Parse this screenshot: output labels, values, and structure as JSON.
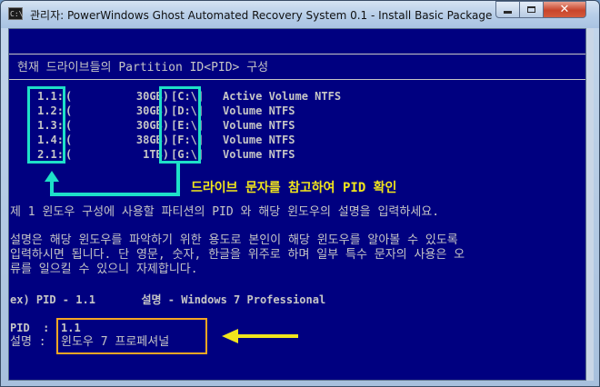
{
  "window": {
    "title": "관리자:  PowerWindows Ghost Automated Recovery System 0.1 - Install Basic Package",
    "icon": "console-app-icon",
    "icon_text": "C:\\",
    "controls": [
      "minimize-icon",
      "maximize-icon",
      "close-icon"
    ]
  },
  "console": {
    "header": "현재 드라이브들의 Partition ID<PID> 구성",
    "partitions": [
      {
        "pid": "1.1:",
        "size": "30GB)",
        "drive": "[C:\\]",
        "desc": "Active Volume NTFS"
      },
      {
        "pid": "1.2:",
        "size": "30GB)",
        "drive": "[D:\\]",
        "desc": "Volume NTFS"
      },
      {
        "pid": "1.3:",
        "size": "30GB)",
        "drive": "[E:\\]",
        "desc": "Volume NTFS"
      },
      {
        "pid": "1.4:",
        "size": "38GB)",
        "drive": "[F:\\]",
        "desc": "Volume NTFS"
      },
      {
        "pid": "2.1:",
        "size": "1TB)",
        "drive": "[G:\\]",
        "desc": "Volume NTFS"
      }
    ],
    "paren_open": "(",
    "annotation_hint": "드라이브 문자를 참고하여 PID 확인",
    "instruction": "제 1 윈도우 구성에 사용할 파티션의 PID 와 해당 윈도우의 설명을 입력하세요.",
    "help_line1": "설명은 해당 윈도우를 파악하기 위한 용도로 본인이 해당 윈도우를 알아볼 수 있도록",
    "help_line2": "입력하시면 됩니다. 단 영문, 숫자, 한글을 위주로 하며 일부 특수 문자의 사용은 오",
    "help_line3": "류를 일으킬 수 있으니 자제합니다.",
    "example": "ex) PID - 1.1       설명 - Windows 7 Professional",
    "pid_prompt": "PID  :",
    "pid_value": "1.1",
    "desc_prompt": "설명 :",
    "desc_value": "윈도우 7 프로페셔널"
  },
  "colors": {
    "console_bg": "#000080",
    "console_text": "#c6c6c6",
    "annotation_cyan": "#1ee0c8",
    "annotation_yellow": "#f1e51c",
    "input_box_orange": "#f5a623"
  }
}
